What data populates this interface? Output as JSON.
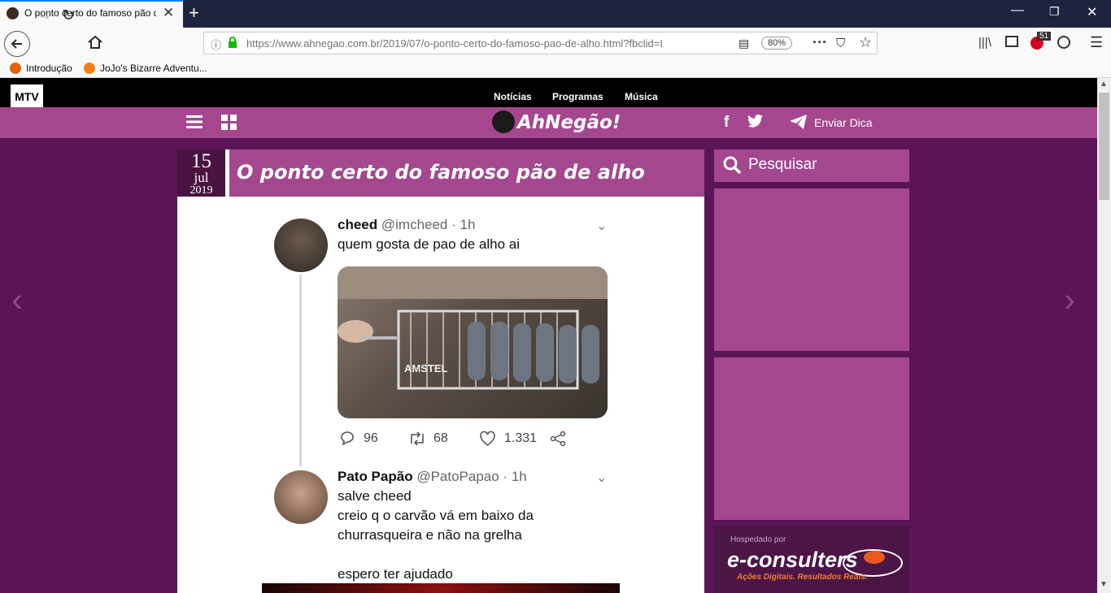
{
  "browser": {
    "tab_title": "O ponto certo do famoso pão de alho",
    "new_tab": "+",
    "url": "https://www.ahnegao.com.br/2019/07/o-ponto-certo-do-famoso-pao-de-alho.html?fbclid=I",
    "zoom": "80%",
    "notifications_badge": "51",
    "bookmarks": [
      "Introdução",
      "JoJo's Bizarre Adventu..."
    ]
  },
  "mtv": {
    "nav": [
      "Notícias",
      "Programas",
      "Música"
    ]
  },
  "site": {
    "logo": "AhNegão!",
    "send_tip": "Enviar Dica"
  },
  "article": {
    "day": "15",
    "month": "jul",
    "year": "2019",
    "title": "O ponto certo do famoso pão de alho"
  },
  "tweets": [
    {
      "name": "cheed",
      "handle": "@imcheed · 1h",
      "lines": [
        "quem gosta de pao de alho ai"
      ],
      "replies": "96",
      "retweets": "68",
      "likes": "1.331"
    },
    {
      "name": "Pato Papão",
      "handle": "@PatoPapao · 1h",
      "lines": [
        "salve cheed",
        "creio q o carvão vá em baixo da",
        "churrasqueira e não na grelha",
        "espero ter ajudado"
      ]
    }
  ],
  "image": {
    "brand_text": "AMSTEL"
  },
  "sidebar": {
    "search_label": "Pesquisar",
    "hosted_by": "Hospedado por",
    "sponsor_name": "e-consulters",
    "sponsor_tagline": "Ações Digitais. Resultados Reais."
  },
  "colors": {
    "accent": "#a4478f",
    "background": "#5b1457",
    "dark_purple": "#4a1240"
  }
}
